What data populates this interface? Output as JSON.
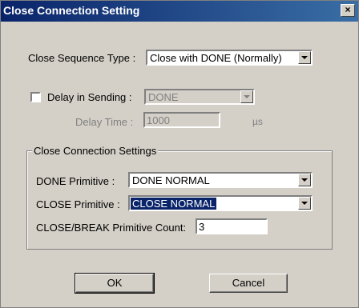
{
  "window": {
    "title": "Close Connection Setting",
    "close_glyph": "×"
  },
  "close_sequence": {
    "label": "Close Sequence Type :",
    "value": "Close with DONE (Normally)"
  },
  "delay": {
    "checkbox_label": "Delay in Sending :",
    "checked": false,
    "value": "DONE",
    "time_label": "Delay Time :",
    "time_value": "1000",
    "unit": "µs"
  },
  "settings_group": {
    "title": "Close Connection Settings",
    "done_label": "DONE Primitive :",
    "done_value": "DONE NORMAL",
    "close_label": "CLOSE Primitive :",
    "close_value": "CLOSE NORMAL",
    "count_label": "CLOSE/BREAK Primitive Count:",
    "count_value": "3"
  },
  "buttons": {
    "ok": "OK",
    "cancel": "Cancel"
  }
}
